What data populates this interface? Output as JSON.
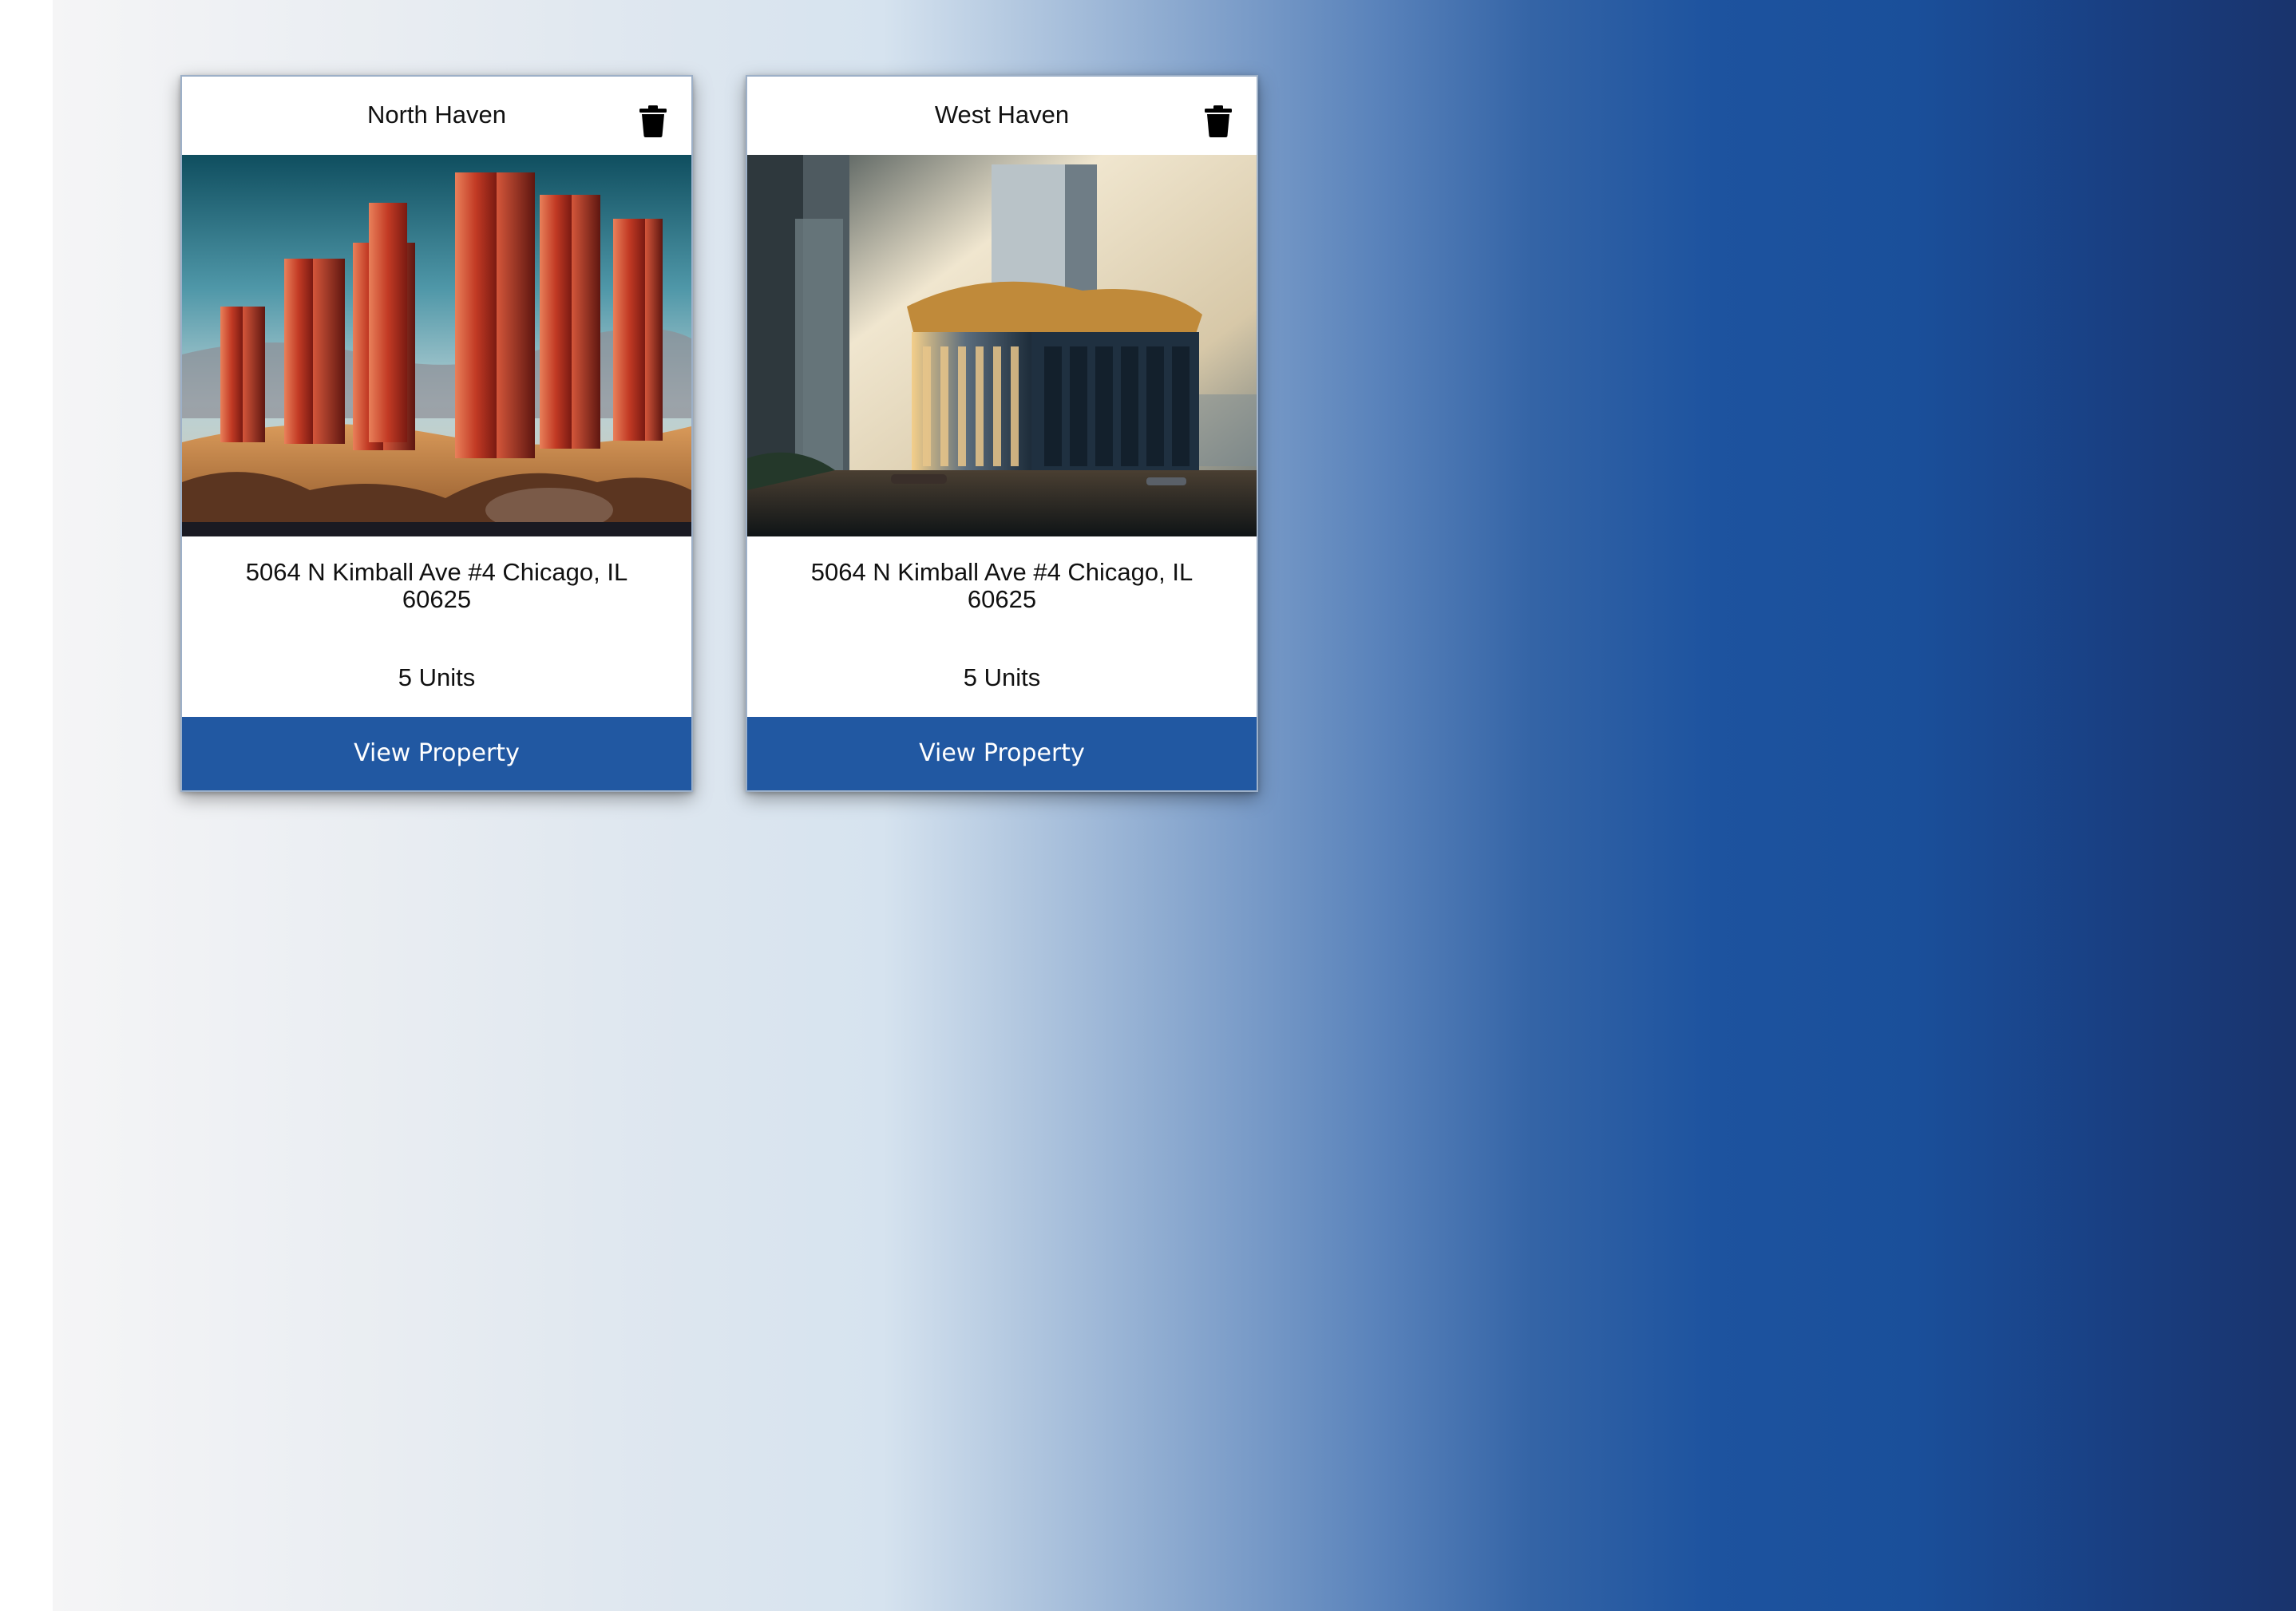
{
  "properties": [
    {
      "name": "North Haven",
      "address": "5064 N Kimball Ave #4 Chicago, IL 60625",
      "units": "5 Units",
      "view_label": "View Property",
      "delete_icon": "trash-icon"
    },
    {
      "name": "West Haven",
      "address": "5064 N Kimball Ave #4 Chicago, IL 60625",
      "units": "5 Units",
      "view_label": "View Property",
      "delete_icon": "trash-icon"
    }
  ],
  "colors": {
    "button": "#2158a2",
    "gradient_end": "#19336c"
  }
}
